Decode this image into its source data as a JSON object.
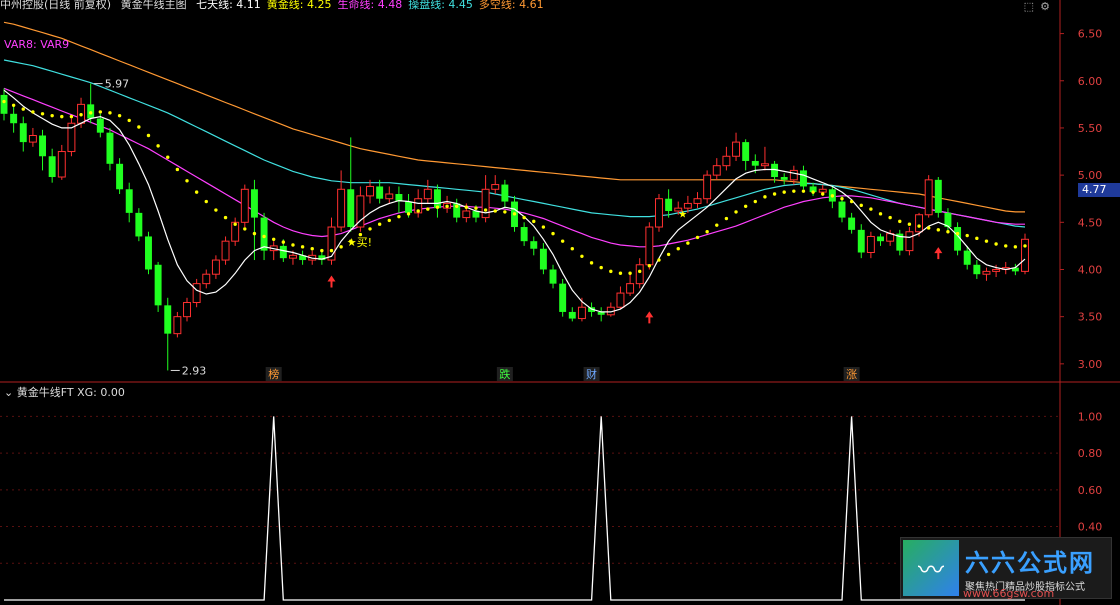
{
  "header": {
    "stock": "中州控股(日线 前复权)",
    "indicator": "黄金牛线主图",
    "items": [
      {
        "label": "七天线:",
        "value": "4.11",
        "color": "#ffffff"
      },
      {
        "label": "黄金线:",
        "value": "4.25",
        "color": "#ffff00"
      },
      {
        "label": "生命线:",
        "value": "4.48",
        "color": "#ff40ff"
      },
      {
        "label": "操盘线:",
        "value": "4.45",
        "color": "#40e0e0"
      },
      {
        "label": "多空线:",
        "value": "4.61",
        "color": "#ff9933"
      }
    ]
  },
  "var_label": "VAR8:  VAR9",
  "current_price": "4.77",
  "markers": {
    "high_label": "5.97",
    "low_label": "2.93",
    "buy_label": "★买!",
    "star_label": "★"
  },
  "signals": [
    {
      "label": "榜",
      "color": "#ff9933",
      "bar": 28
    },
    {
      "label": "跌",
      "color": "#40ff40",
      "bar": 52
    },
    {
      "label": "财",
      "color": "#6fa8ff",
      "bar": 61
    },
    {
      "label": "涨",
      "color": "#ff9933",
      "bar": 88
    }
  ],
  "sub_header": {
    "name": "黄金牛线FT",
    "text": "XG: 0.00"
  },
  "watermark": {
    "title": "六六公式网",
    "subtitle": "聚焦热门精品炒股指标公式",
    "url": "www.66gsw.com"
  },
  "chart_data": {
    "type": "candlestick",
    "ylim": [
      2.85,
      6.75
    ],
    "yticks": [
      "6.50",
      "6.00",
      "5.50",
      "5.00",
      "4.50",
      "4.00",
      "3.50",
      "3.00"
    ],
    "sub_ylim": [
      0,
      1.1
    ],
    "sub_yticks": [
      "1.00",
      "0.80",
      "0.60",
      "0.40",
      "0.20"
    ],
    "candles": [
      [
        5.85,
        5.65,
        5.92,
        5.58
      ],
      [
        5.65,
        5.55,
        5.75,
        5.45
      ],
      [
        5.55,
        5.35,
        5.62,
        5.25
      ],
      [
        5.35,
        5.42,
        5.5,
        5.3
      ],
      [
        5.42,
        5.2,
        5.48,
        5.05
      ],
      [
        5.2,
        4.98,
        5.28,
        4.92
      ],
      [
        4.98,
        5.25,
        5.32,
        4.95
      ],
      [
        5.25,
        5.55,
        5.6,
        5.2
      ],
      [
        5.55,
        5.75,
        5.82,
        5.5
      ],
      [
        5.75,
        5.6,
        5.97,
        5.55
      ],
      [
        5.6,
        5.45,
        5.65,
        5.4
      ],
      [
        5.45,
        5.12,
        5.5,
        5.05
      ],
      [
        5.12,
        4.85,
        5.18,
        4.8
      ],
      [
        4.85,
        4.6,
        4.92,
        4.5
      ],
      [
        4.6,
        4.35,
        4.65,
        4.3
      ],
      [
        4.35,
        4.0,
        4.4,
        3.95
      ],
      [
        4.05,
        3.62,
        4.08,
        3.55
      ],
      [
        3.62,
        3.32,
        3.7,
        2.93
      ],
      [
        3.32,
        3.5,
        3.55,
        3.28
      ],
      [
        3.5,
        3.65,
        3.7,
        3.45
      ],
      [
        3.65,
        3.85,
        3.9,
        3.6
      ],
      [
        3.85,
        3.95,
        4.0,
        3.8
      ],
      [
        3.95,
        4.1,
        4.15,
        3.9
      ],
      [
        4.1,
        4.3,
        4.35,
        4.05
      ],
      [
        4.3,
        4.5,
        4.55,
        4.25
      ],
      [
        4.5,
        4.85,
        4.9,
        4.45
      ],
      [
        4.85,
        4.55,
        4.95,
        4.1
      ],
      [
        4.55,
        4.2,
        4.6,
        4.1
      ],
      [
        4.2,
        4.25,
        4.3,
        4.1
      ],
      [
        4.25,
        4.12,
        4.32,
        4.08
      ],
      [
        4.12,
        4.15,
        4.2,
        4.05
      ],
      [
        4.15,
        4.1,
        4.2,
        4.05
      ],
      [
        4.1,
        4.15,
        4.2,
        4.05
      ],
      [
        4.15,
        4.1,
        4.2,
        4.05
      ],
      [
        4.1,
        4.45,
        4.55,
        4.05
      ],
      [
        4.45,
        4.85,
        5.05,
        4.4
      ],
      [
        4.85,
        4.45,
        5.4,
        4.4
      ],
      [
        4.45,
        4.78,
        4.88,
        4.4
      ],
      [
        4.78,
        4.88,
        4.95,
        4.7
      ],
      [
        4.88,
        4.75,
        4.95,
        4.7
      ],
      [
        4.75,
        4.8,
        4.88,
        4.7
      ],
      [
        4.8,
        4.72,
        4.88,
        4.6
      ],
      [
        4.72,
        4.6,
        4.8,
        4.55
      ],
      [
        4.6,
        4.75,
        4.85,
        4.55
      ],
      [
        4.75,
        4.85,
        4.95,
        4.7
      ],
      [
        4.85,
        4.65,
        4.9,
        4.55
      ],
      [
        4.65,
        4.7,
        4.78,
        4.6
      ],
      [
        4.7,
        4.55,
        4.75,
        4.5
      ],
      [
        4.55,
        4.62,
        4.7,
        4.5
      ],
      [
        4.62,
        4.55,
        4.68,
        4.5
      ],
      [
        4.55,
        4.85,
        5.0,
        4.5
      ],
      [
        4.85,
        4.9,
        5.0,
        4.8
      ],
      [
        4.9,
        4.72,
        4.95,
        4.65
      ],
      [
        4.72,
        4.45,
        4.78,
        4.4
      ],
      [
        4.45,
        4.3,
        4.5,
        4.25
      ],
      [
        4.3,
        4.22,
        4.35,
        4.15
      ],
      [
        4.22,
        4.0,
        4.28,
        3.95
      ],
      [
        4.0,
        3.85,
        4.05,
        3.8
      ],
      [
        3.85,
        3.55,
        3.9,
        3.5
      ],
      [
        3.55,
        3.48,
        3.6,
        3.45
      ],
      [
        3.48,
        3.6,
        3.7,
        3.45
      ],
      [
        3.6,
        3.55,
        3.65,
        3.5
      ],
      [
        3.55,
        3.52,
        3.6,
        3.45
      ],
      [
        3.52,
        3.6,
        3.65,
        3.5
      ],
      [
        3.6,
        3.75,
        3.82,
        3.58
      ],
      [
        3.75,
        3.85,
        3.95,
        3.72
      ],
      [
        3.85,
        4.05,
        4.12,
        3.8
      ],
      [
        4.05,
        4.45,
        4.5,
        4.0
      ],
      [
        4.45,
        4.75,
        4.8,
        4.4
      ],
      [
        4.75,
        4.62,
        4.85,
        4.55
      ],
      [
        4.62,
        4.65,
        4.72,
        4.58
      ],
      [
        4.65,
        4.7,
        4.78,
        4.6
      ],
      [
        4.7,
        4.75,
        4.82,
        4.65
      ],
      [
        4.75,
        5.0,
        5.05,
        4.7
      ],
      [
        5.0,
        5.1,
        5.18,
        4.95
      ],
      [
        5.1,
        5.2,
        5.3,
        5.05
      ],
      [
        5.2,
        5.35,
        5.45,
        5.15
      ],
      [
        5.35,
        5.15,
        5.38,
        5.05
      ],
      [
        5.15,
        5.1,
        5.22,
        5.02
      ],
      [
        5.1,
        5.12,
        5.3,
        5.05
      ],
      [
        5.12,
        4.98,
        5.15,
        4.92
      ],
      [
        4.98,
        4.95,
        5.02,
        4.9
      ],
      [
        4.95,
        5.05,
        5.1,
        4.9
      ],
      [
        5.05,
        4.88,
        5.1,
        4.85
      ],
      [
        4.88,
        4.82,
        4.92,
        4.78
      ],
      [
        4.82,
        4.85,
        4.9,
        4.78
      ],
      [
        4.85,
        4.72,
        4.88,
        4.65
      ],
      [
        4.72,
        4.55,
        4.78,
        4.5
      ],
      [
        4.55,
        4.42,
        4.6,
        4.38
      ],
      [
        4.42,
        4.18,
        4.48,
        4.12
      ],
      [
        4.18,
        4.35,
        4.4,
        4.12
      ],
      [
        4.35,
        4.3,
        4.38,
        4.25
      ],
      [
        4.3,
        4.38,
        4.42,
        4.25
      ],
      [
        4.38,
        4.2,
        4.42,
        4.15
      ],
      [
        4.2,
        4.4,
        4.45,
        4.15
      ],
      [
        4.4,
        4.58,
        4.6,
        4.35
      ],
      [
        4.58,
        4.95,
        5.0,
        4.55
      ],
      [
        4.95,
        4.6,
        4.98,
        4.55
      ],
      [
        4.6,
        4.45,
        4.65,
        4.4
      ],
      [
        4.45,
        4.2,
        4.5,
        4.15
      ],
      [
        4.2,
        4.05,
        4.25,
        4.0
      ],
      [
        4.05,
        3.95,
        4.1,
        3.9
      ],
      [
        3.95,
        3.98,
        4.02,
        3.88
      ],
      [
        3.98,
        4.0,
        4.05,
        3.92
      ],
      [
        4.0,
        4.02,
        4.08,
        3.95
      ],
      [
        4.02,
        3.98,
        4.06,
        3.94
      ],
      [
        3.98,
        4.32,
        4.38,
        3.95
      ]
    ],
    "line_seven": [
      5.9,
      5.82,
      5.73,
      5.66,
      5.6,
      5.54,
      5.5,
      5.5,
      5.55,
      5.6,
      5.62,
      5.58,
      5.48,
      5.32,
      5.12,
      4.9,
      4.62,
      4.32,
      4.05,
      3.88,
      3.78,
      3.74,
      3.76,
      3.84,
      3.96,
      4.1,
      4.2,
      4.24,
      4.22,
      4.2,
      4.18,
      4.15,
      4.12,
      4.11,
      4.14,
      4.3,
      4.42,
      4.52,
      4.6,
      4.66,
      4.7,
      4.73,
      4.72,
      4.7,
      4.7,
      4.7,
      4.72,
      4.7,
      4.66,
      4.62,
      4.6,
      4.62,
      4.66,
      4.64,
      4.56,
      4.46,
      4.32,
      4.16,
      3.96,
      3.78,
      3.66,
      3.58,
      3.55,
      3.55,
      3.58,
      3.65,
      3.76,
      3.92,
      4.12,
      4.3,
      4.42,
      4.5,
      4.58,
      4.66,
      4.76,
      4.86,
      4.96,
      5.02,
      5.05,
      5.06,
      5.06,
      5.04,
      5.02,
      5.0,
      4.96,
      4.92,
      4.88,
      4.82,
      4.74,
      4.62,
      4.5,
      4.42,
      4.38,
      4.35,
      4.34,
      4.38,
      4.46,
      4.5,
      4.46,
      4.36,
      4.24,
      4.12,
      4.05,
      4.02,
      4.0,
      4.02,
      4.11
    ],
    "line_gold": [
      5.78,
      5.74,
      5.7,
      5.67,
      5.65,
      5.63,
      5.62,
      5.62,
      5.64,
      5.66,
      5.67,
      5.66,
      5.63,
      5.58,
      5.51,
      5.42,
      5.31,
      5.19,
      5.06,
      4.94,
      4.82,
      4.72,
      4.63,
      4.55,
      4.48,
      4.43,
      4.38,
      4.35,
      4.32,
      4.29,
      4.26,
      4.24,
      4.22,
      4.2,
      4.2,
      4.24,
      4.3,
      4.37,
      4.43,
      4.48,
      4.52,
      4.56,
      4.59,
      4.62,
      4.64,
      4.66,
      4.67,
      4.67,
      4.66,
      4.65,
      4.63,
      4.62,
      4.61,
      4.59,
      4.55,
      4.51,
      4.45,
      4.38,
      4.3,
      4.22,
      4.14,
      4.07,
      4.02,
      3.98,
      3.96,
      3.96,
      3.98,
      4.04,
      4.1,
      4.16,
      4.22,
      4.28,
      4.34,
      4.4,
      4.47,
      4.54,
      4.61,
      4.67,
      4.72,
      4.77,
      4.8,
      4.82,
      4.83,
      4.83,
      4.82,
      4.8,
      4.78,
      4.75,
      4.72,
      4.68,
      4.64,
      4.59,
      4.55,
      4.51,
      4.48,
      4.46,
      4.44,
      4.42,
      4.4,
      4.38,
      4.36,
      4.33,
      4.3,
      4.27,
      4.25,
      4.24,
      4.25
    ],
    "line_life": [
      5.92,
      5.88,
      5.84,
      5.8,
      5.76,
      5.72,
      5.68,
      5.64,
      5.6,
      5.56,
      5.52,
      5.48,
      5.43,
      5.38,
      5.33,
      5.28,
      5.22,
      5.16,
      5.1,
      5.04,
      4.98,
      4.92,
      4.86,
      4.8,
      4.74,
      4.68,
      4.62,
      4.56,
      4.5,
      4.45,
      4.41,
      4.38,
      4.36,
      4.35,
      4.36,
      4.38,
      4.42,
      4.46,
      4.5,
      4.54,
      4.57,
      4.6,
      4.62,
      4.64,
      4.65,
      4.66,
      4.67,
      4.67,
      4.67,
      4.66,
      4.66,
      4.65,
      4.64,
      4.62,
      4.6,
      4.57,
      4.54,
      4.5,
      4.46,
      4.42,
      4.38,
      4.34,
      4.31,
      4.28,
      4.26,
      4.25,
      4.24,
      4.24,
      4.25,
      4.27,
      4.29,
      4.31,
      4.34,
      4.37,
      4.4,
      4.43,
      4.46,
      4.5,
      4.54,
      4.58,
      4.62,
      4.66,
      4.69,
      4.72,
      4.74,
      4.76,
      4.77,
      4.78,
      4.78,
      4.77,
      4.76,
      4.74,
      4.72,
      4.7,
      4.68,
      4.66,
      4.64,
      4.62,
      4.6,
      4.58,
      4.56,
      4.54,
      4.52,
      4.5,
      4.49,
      4.48,
      4.48
    ],
    "line_trade": [
      6.22,
      6.2,
      6.18,
      6.16,
      6.13,
      6.1,
      6.07,
      6.04,
      6.01,
      5.98,
      5.94,
      5.9,
      5.86,
      5.82,
      5.78,
      5.74,
      5.7,
      5.66,
      5.61,
      5.56,
      5.51,
      5.46,
      5.41,
      5.36,
      5.31,
      5.26,
      5.21,
      5.16,
      5.12,
      5.08,
      5.04,
      5.01,
      4.98,
      4.96,
      4.94,
      4.93,
      4.92,
      4.92,
      4.92,
      4.92,
      4.92,
      4.91,
      4.9,
      4.89,
      4.88,
      4.87,
      4.86,
      4.85,
      4.84,
      4.83,
      4.82,
      4.8,
      4.78,
      4.76,
      4.74,
      4.72,
      4.7,
      4.68,
      4.66,
      4.64,
      4.62,
      4.6,
      4.59,
      4.58,
      4.57,
      4.56,
      4.56,
      4.56,
      4.57,
      4.58,
      4.6,
      4.62,
      4.64,
      4.67,
      4.7,
      4.73,
      4.76,
      4.79,
      4.82,
      4.85,
      4.87,
      4.89,
      4.9,
      4.91,
      4.91,
      4.9,
      4.89,
      4.87,
      4.85,
      4.82,
      4.79,
      4.76,
      4.73,
      4.7,
      4.68,
      4.66,
      4.64,
      4.62,
      4.6,
      4.58,
      4.56,
      4.54,
      4.52,
      4.5,
      4.48,
      4.46,
      4.45
    ],
    "line_longshort": [
      6.62,
      6.6,
      6.57,
      6.54,
      6.51,
      6.48,
      6.45,
      6.41,
      6.37,
      6.33,
      6.29,
      6.25,
      6.21,
      6.17,
      6.13,
      6.09,
      6.05,
      6.01,
      5.97,
      5.93,
      5.89,
      5.85,
      5.81,
      5.77,
      5.73,
      5.69,
      5.65,
      5.61,
      5.57,
      5.53,
      5.49,
      5.46,
      5.43,
      5.4,
      5.37,
      5.34,
      5.31,
      5.28,
      5.26,
      5.24,
      5.22,
      5.2,
      5.18,
      5.16,
      5.15,
      5.14,
      5.13,
      5.12,
      5.11,
      5.1,
      5.09,
      5.08,
      5.07,
      5.06,
      5.05,
      5.04,
      5.03,
      5.02,
      5.01,
      5.0,
      4.99,
      4.98,
      4.97,
      4.96,
      4.95,
      4.95,
      4.95,
      4.95,
      4.95,
      4.95,
      4.95,
      4.95,
      4.95,
      4.95,
      4.95,
      4.95,
      4.95,
      4.95,
      4.95,
      4.95,
      4.95,
      4.94,
      4.93,
      4.92,
      4.91,
      4.9,
      4.89,
      4.88,
      4.87,
      4.86,
      4.85,
      4.84,
      4.83,
      4.82,
      4.81,
      4.8,
      4.78,
      4.76,
      4.74,
      4.72,
      4.7,
      4.68,
      4.66,
      4.64,
      4.62,
      4.61,
      4.61
    ],
    "sub_spikes": [
      28,
      62,
      88
    ],
    "sub_values_note": "XG spikes to 1.00 at signal bars"
  }
}
